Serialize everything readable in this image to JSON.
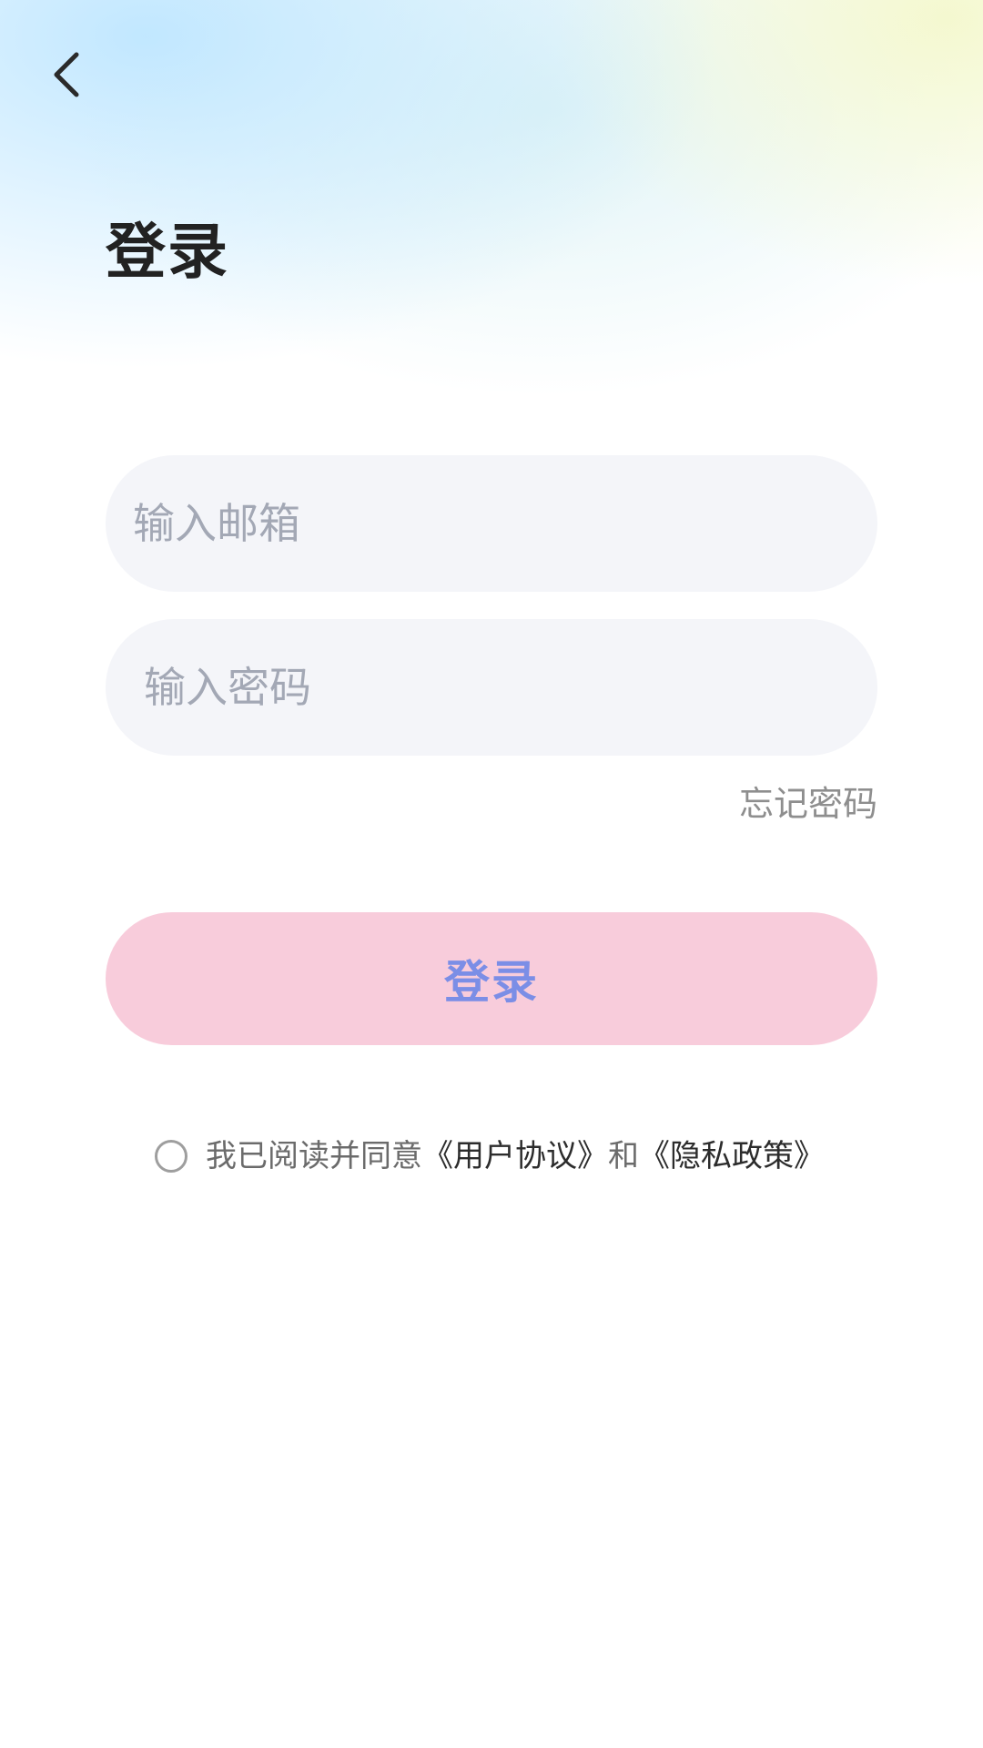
{
  "header": {
    "back_icon": "chevron-left-icon"
  },
  "page": {
    "title": "登录"
  },
  "form": {
    "email_placeholder": "输入邮箱",
    "password_placeholder": "输入密码",
    "forgot_password": "忘记密码",
    "login_button": "登录"
  },
  "agreement": {
    "checkbox_icon": "radio-circle-icon",
    "checked": false,
    "prefix": "我已阅读并同意",
    "user_agreement": "《用户协议》",
    "conjunction": "和",
    "privacy_policy": "《隐私政策》"
  },
  "colors": {
    "login_button_bg": "#f8ccdb",
    "login_button_text": "#7b8ee6",
    "input_bg": "#f4f5f9"
  }
}
